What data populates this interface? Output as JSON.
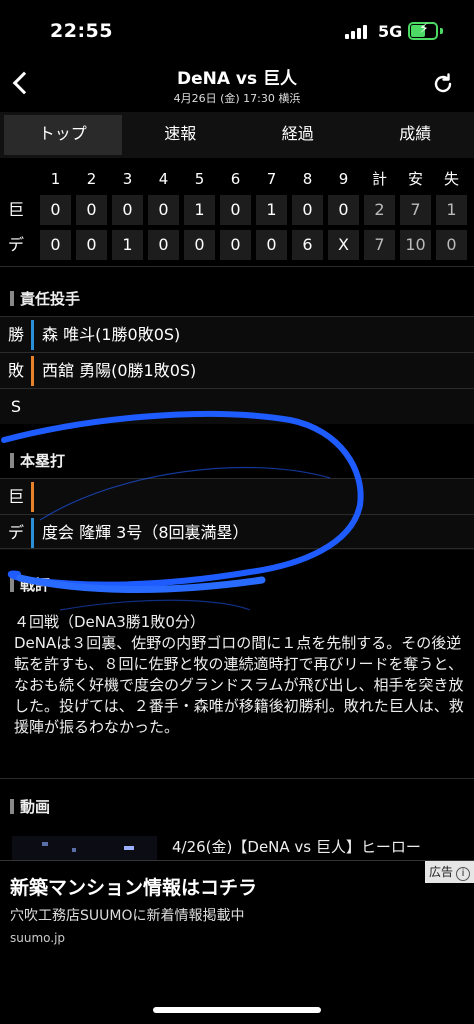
{
  "status_bar": {
    "time": "22:55",
    "network": "5G"
  },
  "header": {
    "title": "DeNA vs 巨人",
    "subtitle": "4月26日 (金) 17:30 横浜",
    "back_icon": "chevron-left-icon",
    "reload_icon": "reload-icon"
  },
  "tabs": [
    "トップ",
    "速報",
    "経過",
    "成績"
  ],
  "scoreboard": {
    "columns": [
      "1",
      "2",
      "3",
      "4",
      "5",
      "6",
      "7",
      "8",
      "9",
      "計",
      "安",
      "失"
    ],
    "rows": [
      {
        "team": "巨",
        "innings": [
          "0",
          "0",
          "0",
          "0",
          "1",
          "0",
          "1",
          "0",
          "0"
        ],
        "totals": [
          "2",
          "7",
          "1"
        ]
      },
      {
        "team": "デ",
        "innings": [
          "0",
          "0",
          "1",
          "0",
          "0",
          "0",
          "0",
          "6",
          "X"
        ],
        "totals": [
          "7",
          "10",
          "0"
        ]
      }
    ]
  },
  "pitchers": {
    "heading": "責任投手",
    "rows": [
      {
        "key": "勝",
        "value": "森 唯斗(1勝0敗0S)",
        "color": "#2a8fd6"
      },
      {
        "key": "敗",
        "value": "西舘 勇陽(0勝1敗0S)",
        "color": "#e8822a"
      },
      {
        "key": "S",
        "value": "",
        "color": ""
      }
    ]
  },
  "homeruns": {
    "heading": "本塁打",
    "rows": [
      {
        "key": "巨",
        "value": "",
        "color": "#e8822a"
      },
      {
        "key": "デ",
        "value": "度会 隆輝 3号（8回裏満塁）",
        "color": "#2a8fd6"
      }
    ]
  },
  "review": {
    "heading": "戦評",
    "lead": "４回戦（DeNA3勝1敗0分）",
    "body": "DeNAは３回裏、佐野の内野ゴロの間に１点を先制する。その後逆転を許すも、８回に佐野と牧の連続適時打で再びリードを奪うと、なおも続く好機で度会のグランドスラムが飛び出し、相手を突き放した。投げては、２番手・森唯が移籍後初勝利。敗れた巨人は、救援陣が振るわなかった。"
  },
  "video": {
    "heading": "動画",
    "title": "4/26(金)【DeNA vs 巨人】ヒーロー"
  },
  "ad": {
    "tag": "広告",
    "title": "新築マンション情報はコチラ",
    "sub": "穴吹工務店SUUMOに新着情報掲載中",
    "url": "suumo.jp"
  },
  "colors": {
    "win": "#2a8fd6",
    "lose": "#e8822a",
    "scribble": "#1f5cff"
  }
}
